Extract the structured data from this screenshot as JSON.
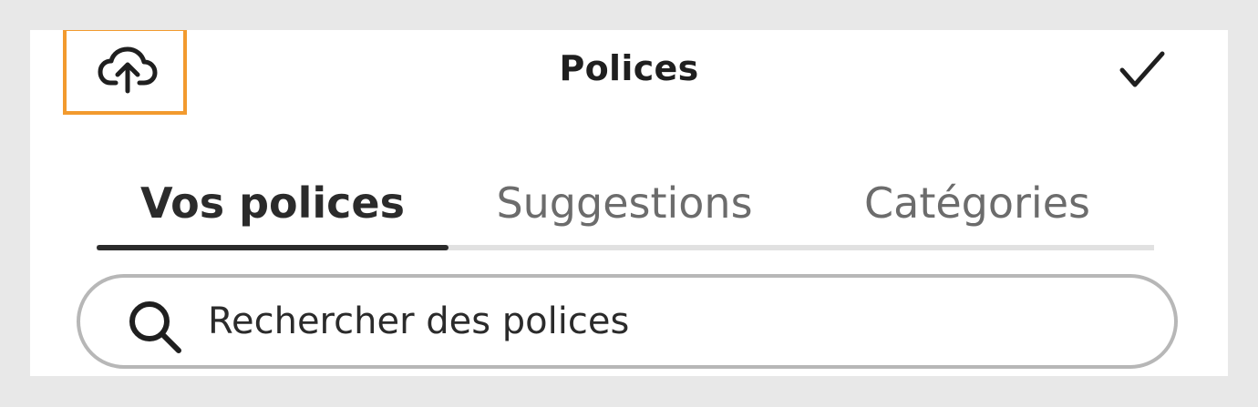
{
  "header": {
    "title": "Polices",
    "upload_icon": "cloud-upload-icon",
    "confirm_icon": "checkmark-icon",
    "highlight_color": "#f29a2e"
  },
  "tabs": [
    {
      "label": "Vos polices",
      "active": true
    },
    {
      "label": "Suggestions",
      "active": false
    },
    {
      "label": "Catégories",
      "active": false
    }
  ],
  "search": {
    "placeholder": "Rechercher des polices",
    "value": "",
    "icon": "search-icon"
  },
  "colors": {
    "background": "#e8e8e8",
    "panel": "#ffffff",
    "text_primary": "#2b2b2b",
    "text_secondary": "#6c6c6c",
    "tab_track": "#e1e1e1",
    "search_border": "#b7b7b7"
  }
}
